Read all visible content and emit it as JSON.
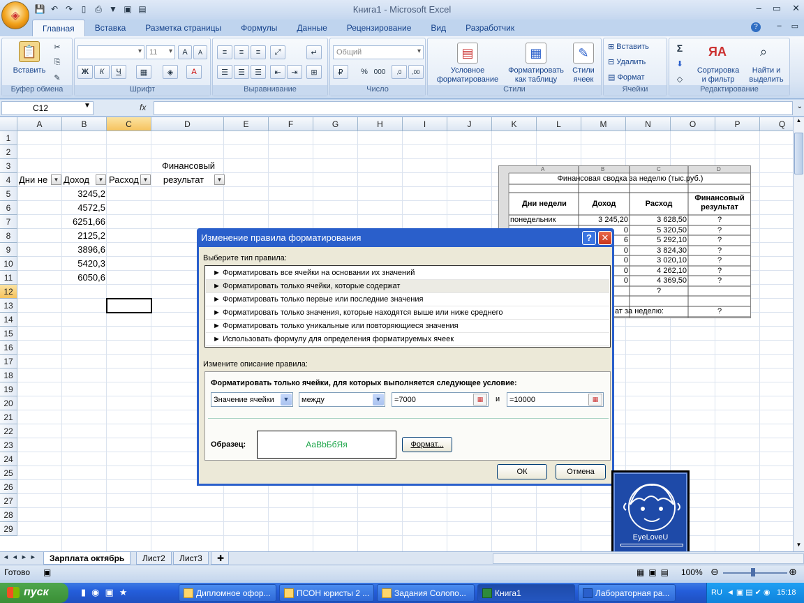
{
  "window": {
    "title": "Книга1 - Microsoft Excel"
  },
  "ribbon": {
    "tabs": [
      "Главная",
      "Вставка",
      "Разметка страницы",
      "Формулы",
      "Данные",
      "Рецензирование",
      "Вид",
      "Разработчик"
    ],
    "clipboard": {
      "paste": "Вставить",
      "label": "Буфер обмена"
    },
    "font": {
      "name": "",
      "size": "11",
      "label": "Шрифт"
    },
    "alignment": {
      "label": "Выравнивание"
    },
    "number": {
      "format": "Общий",
      "label": "Число"
    },
    "styles": {
      "conditional": "Условное\nформатирование",
      "table": "Форматировать\nкак таблицу",
      "cell": "Стили\nячеек",
      "label": "Стили"
    },
    "cells": {
      "insert": "Вставить",
      "delete": "Удалить",
      "format": "Формат",
      "label": "Ячейки"
    },
    "editing": {
      "sort": "Сортировка\nи фильтр",
      "find": "Найти и\nвыделить",
      "label": "Редактирование"
    }
  },
  "formula_bar": {
    "cell": "C12",
    "fx": "fx",
    "value": ""
  },
  "sheet": {
    "columns": [
      "A",
      "B",
      "C",
      "D",
      "E",
      "F",
      "G",
      "H",
      "I",
      "J",
      "K",
      "L",
      "M",
      "N",
      "O",
      "P",
      "Q"
    ],
    "rows": [
      "1",
      "2",
      "3",
      "4",
      "5",
      "6",
      "7",
      "8",
      "9",
      "10",
      "11",
      "12",
      "13",
      "14",
      "15",
      "16",
      "17",
      "18",
      "19",
      "20",
      "21",
      "22",
      "23",
      "24",
      "25",
      "26",
      "27",
      "28",
      "29"
    ],
    "headers": {
      "a3": "Дни не",
      "b3": "Доход",
      "c3": "Расход",
      "d2": "Финансовый",
      "d3": "результат"
    },
    "income": [
      "3245,2",
      "4572,5",
      "6251,66",
      "2125,2",
      "3896,6",
      "5420,3",
      "6050,6"
    ]
  },
  "picture": {
    "cols": [
      "A",
      "B",
      "C",
      "D"
    ],
    "title": "Финансовая сводка за неделю (тыс.руб.)",
    "h1": "Дни недели",
    "h2": "Доход",
    "h3": "Расход",
    "h4": "Финансовый результат",
    "rows": [
      [
        "понедельник",
        "3 245,20",
        "3 628,50",
        "?"
      ],
      [
        "",
        "0",
        "5 320,50",
        "?"
      ],
      [
        "",
        "6",
        "5 292,10",
        "?"
      ],
      [
        "",
        "0",
        "3 824,30",
        "?"
      ],
      [
        "",
        "0",
        "3 020,10",
        "?"
      ],
      [
        "",
        "0",
        "4 262,10",
        "?"
      ],
      [
        "",
        "0",
        "4 369,50",
        "?"
      ]
    ],
    "q": "?",
    "total": "ат за неделю:",
    "total_q": "?"
  },
  "dialog": {
    "title": "Изменение правила форматирования",
    "select_type": "Выберите тип правила:",
    "rules": [
      "► Форматировать все ячейки на основании их значений",
      "► Форматировать только ячейки, которые содержат",
      "► Форматировать только первые или последние значения",
      "► Форматировать только значения, которые находятся выше или ниже среднего",
      "► Форматировать только уникальные или повторяющиеся значения",
      "► Использовать формулу для определения форматируемых ячеек"
    ],
    "edit_desc": "Измените описание правила:",
    "condition_title": "Форматировать только ячейки, для которых выполняется следующее условие:",
    "op1": "Значение ячейки",
    "op2": "между",
    "v1": "=7000",
    "and": "и",
    "v2": "=10000",
    "sample_label": "Образец:",
    "sample": "АаВbБбЯя",
    "format_btn": "Формат...",
    "ok": "ОК",
    "cancel": "Отмена"
  },
  "sheet_tabs": [
    "Зарплата октябрь",
    "Лист2",
    "Лист3"
  ],
  "status": {
    "ready": "Готово",
    "zoom": "100%"
  },
  "taskbar": {
    "start": "пуск",
    "items": [
      "Дипломное офор...",
      "ПСОН юристы 2 ...",
      "Задания Солопо...",
      "Книга1",
      "Лабораторная ра..."
    ],
    "lang": "RU",
    "time": "15:18"
  },
  "logo": {
    "text": "EyeLoveU"
  }
}
